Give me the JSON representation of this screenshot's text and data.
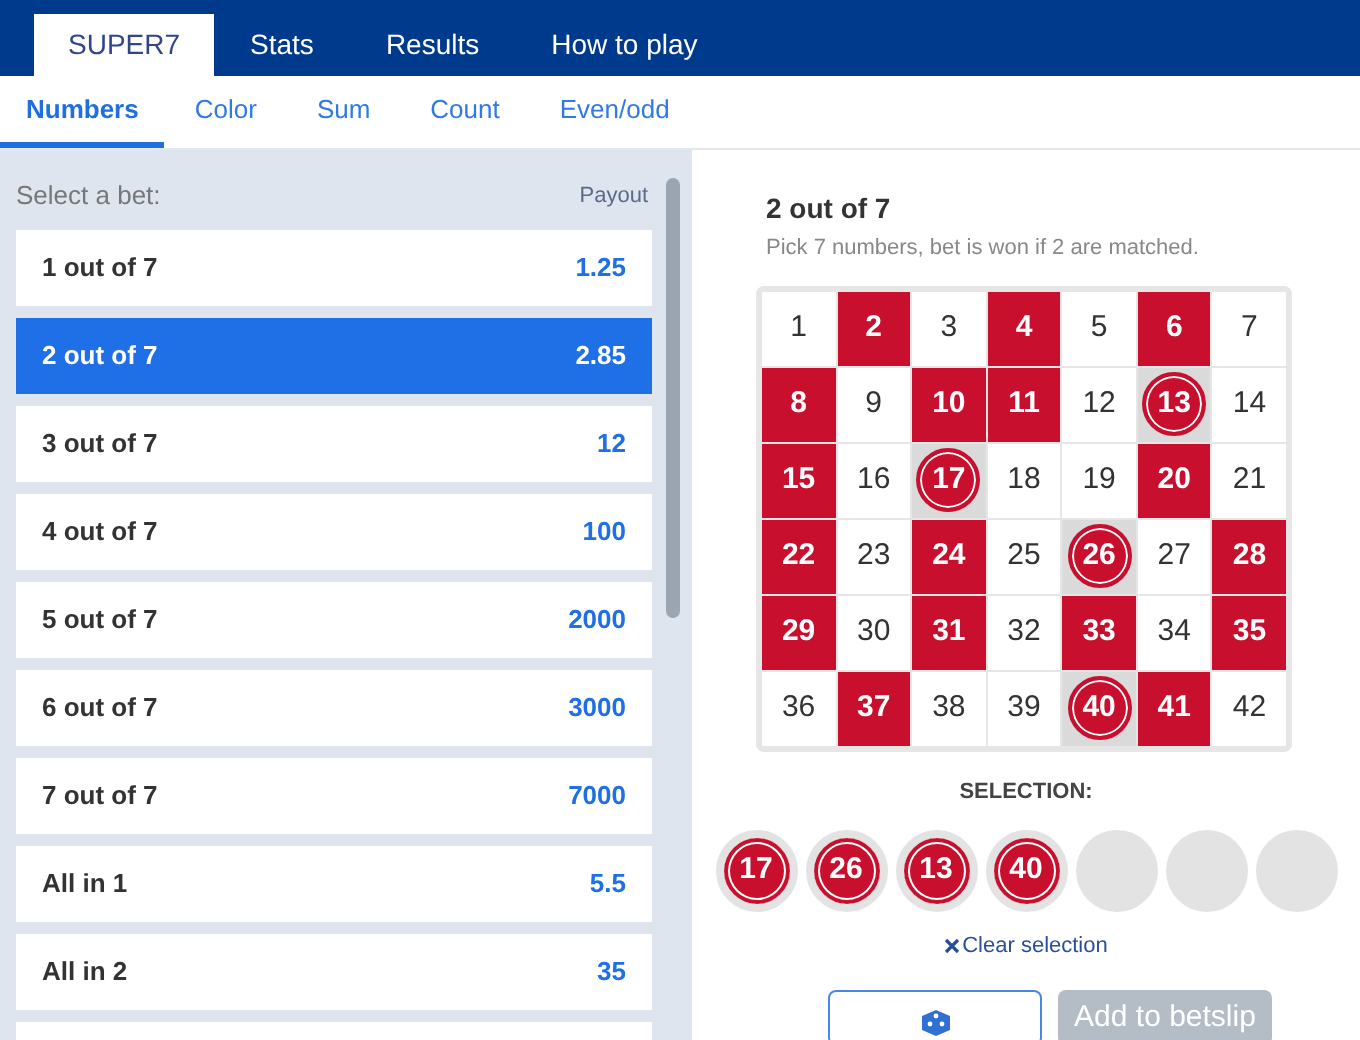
{
  "top_tabs": [
    {
      "label": "SUPER7",
      "selected": true
    },
    {
      "label": "Stats",
      "selected": false
    },
    {
      "label": "Results",
      "selected": false
    },
    {
      "label": "How to play",
      "selected": false
    }
  ],
  "sub_tabs": [
    {
      "label": "Numbers",
      "selected": true
    },
    {
      "label": "Color",
      "selected": false
    },
    {
      "label": "Sum",
      "selected": false
    },
    {
      "label": "Count",
      "selected": false
    },
    {
      "label": "Even/odd",
      "selected": false
    }
  ],
  "bets": {
    "label": "Select a bet:",
    "payout_header": "Payout",
    "items": [
      {
        "name": "1 out of 7",
        "payout": "1.25",
        "selected": false
      },
      {
        "name": "2 out of 7",
        "payout": "2.85",
        "selected": true
      },
      {
        "name": "3 out of 7",
        "payout": "12",
        "selected": false
      },
      {
        "name": "4 out of 7",
        "payout": "100",
        "selected": false
      },
      {
        "name": "5 out of 7",
        "payout": "2000",
        "selected": false
      },
      {
        "name": "6 out of 7",
        "payout": "3000",
        "selected": false
      },
      {
        "name": "7 out of 7",
        "payout": "7000",
        "selected": false
      },
      {
        "name": "All in 1",
        "payout": "5.5",
        "selected": false
      },
      {
        "name": "All in 2",
        "payout": "35",
        "selected": false
      }
    ]
  },
  "bet_detail": {
    "title": "2 out of 7",
    "description": "Pick 7 numbers, bet is won if 2 are matched."
  },
  "grid": [
    {
      "n": "1",
      "drawn": false,
      "selected": false
    },
    {
      "n": "2",
      "drawn": true,
      "selected": false
    },
    {
      "n": "3",
      "drawn": false,
      "selected": false
    },
    {
      "n": "4",
      "drawn": true,
      "selected": false
    },
    {
      "n": "5",
      "drawn": false,
      "selected": false
    },
    {
      "n": "6",
      "drawn": true,
      "selected": false
    },
    {
      "n": "7",
      "drawn": false,
      "selected": false
    },
    {
      "n": "8",
      "drawn": true,
      "selected": false
    },
    {
      "n": "9",
      "drawn": false,
      "selected": false
    },
    {
      "n": "10",
      "drawn": true,
      "selected": false
    },
    {
      "n": "11",
      "drawn": true,
      "selected": false
    },
    {
      "n": "12",
      "drawn": false,
      "selected": false
    },
    {
      "n": "13",
      "drawn": false,
      "selected": true
    },
    {
      "n": "14",
      "drawn": false,
      "selected": false
    },
    {
      "n": "15",
      "drawn": true,
      "selected": false
    },
    {
      "n": "16",
      "drawn": false,
      "selected": false
    },
    {
      "n": "17",
      "drawn": false,
      "selected": true
    },
    {
      "n": "18",
      "drawn": false,
      "selected": false
    },
    {
      "n": "19",
      "drawn": false,
      "selected": false
    },
    {
      "n": "20",
      "drawn": true,
      "selected": false
    },
    {
      "n": "21",
      "drawn": false,
      "selected": false
    },
    {
      "n": "22",
      "drawn": true,
      "selected": false
    },
    {
      "n": "23",
      "drawn": false,
      "selected": false
    },
    {
      "n": "24",
      "drawn": true,
      "selected": false
    },
    {
      "n": "25",
      "drawn": false,
      "selected": false
    },
    {
      "n": "26",
      "drawn": false,
      "selected": true
    },
    {
      "n": "27",
      "drawn": false,
      "selected": false
    },
    {
      "n": "28",
      "drawn": true,
      "selected": false
    },
    {
      "n": "29",
      "drawn": true,
      "selected": false
    },
    {
      "n": "30",
      "drawn": false,
      "selected": false
    },
    {
      "n": "31",
      "drawn": true,
      "selected": false
    },
    {
      "n": "32",
      "drawn": false,
      "selected": false
    },
    {
      "n": "33",
      "drawn": true,
      "selected": false
    },
    {
      "n": "34",
      "drawn": false,
      "selected": false
    },
    {
      "n": "35",
      "drawn": true,
      "selected": false
    },
    {
      "n": "36",
      "drawn": false,
      "selected": false
    },
    {
      "n": "37",
      "drawn": true,
      "selected": false
    },
    {
      "n": "38",
      "drawn": false,
      "selected": false
    },
    {
      "n": "39",
      "drawn": false,
      "selected": false
    },
    {
      "n": "40",
      "drawn": false,
      "selected": true
    },
    {
      "n": "41",
      "drawn": true,
      "selected": false
    },
    {
      "n": "42",
      "drawn": false,
      "selected": false
    }
  ],
  "selection": {
    "label": "SELECTION:",
    "slots": [
      {
        "kind": "ball",
        "number": "17"
      },
      {
        "kind": "ball",
        "number": "26"
      },
      {
        "kind": "ball",
        "number": "13"
      },
      {
        "kind": "ball",
        "number": "40"
      },
      {
        "kind": "empty"
      },
      {
        "kind": "empty"
      },
      {
        "kind": "empty"
      }
    ],
    "clear": "Clear selection"
  },
  "actions": {
    "add_to_betslip": {
      "label": "Add to betslip",
      "disabled": true
    }
  }
}
